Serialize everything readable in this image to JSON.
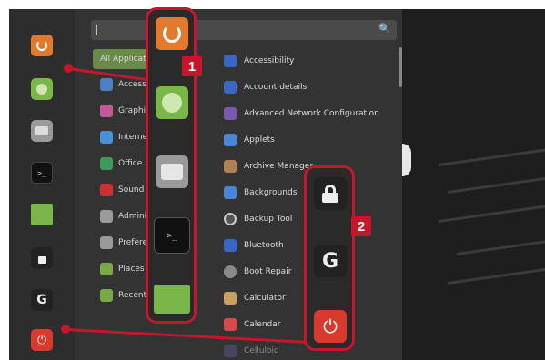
{
  "menu": {
    "categories": [
      {
        "label": "All Applications",
        "color": "#7a9a52"
      },
      {
        "label": "Accessories",
        "color": "#4d7fc2"
      },
      {
        "label": "Graphics",
        "color": "#c05a9a"
      },
      {
        "label": "Internet",
        "color": "#4a90d6"
      },
      {
        "label": "Office",
        "color": "#3f9a5a"
      },
      {
        "label": "Sound & Video",
        "color": "#c83232"
      },
      {
        "label": "Administration",
        "color": "#9a9a9a"
      },
      {
        "label": "Preferences",
        "color": "#9a9a9a"
      },
      {
        "label": "Places",
        "color": "#7aaa48"
      },
      {
        "label": "Recent Files",
        "color": "#7aaa48"
      }
    ],
    "apps": [
      {
        "label": "Accessibility",
        "color": "#3a66c4"
      },
      {
        "label": "Account details",
        "color": "#3a66c4"
      },
      {
        "label": "Advanced Network Configuration",
        "color": "#7a5ab0"
      },
      {
        "label": "Applets",
        "color": "#4a86d6"
      },
      {
        "label": "Archive Manager",
        "color": "#b08050"
      },
      {
        "label": "Backgrounds",
        "color": "#4a86d6"
      },
      {
        "label": "Backup Tool",
        "color": "#555555"
      },
      {
        "label": "Bluetooth",
        "color": "#3a66c4"
      },
      {
        "label": "Boot Repair",
        "color": "#8a8a8a"
      },
      {
        "label": "Calculator",
        "color": "#c8a060"
      },
      {
        "label": "Calendar",
        "color": "#d84a4a"
      },
      {
        "label": "Celluloid",
        "color": "#5a5a8a"
      }
    ]
  },
  "callouts": {
    "one": "1",
    "two": "2"
  },
  "colors": {
    "accent": "#c4172c",
    "menu_bg": "#333333",
    "panel_bg": "#2d2d2d"
  }
}
